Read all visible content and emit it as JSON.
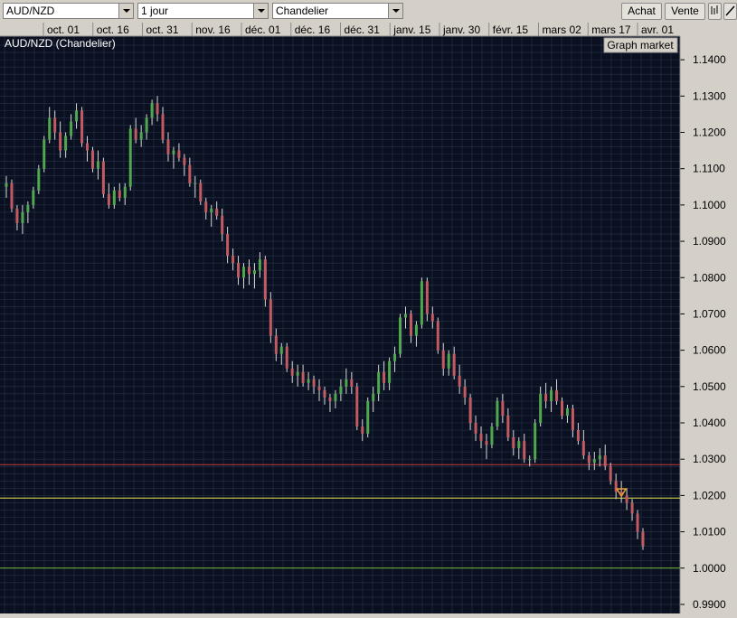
{
  "toolbar": {
    "instrument": "AUD/NZD",
    "timeframe": "1 jour",
    "chart_style": "Chandelier",
    "buy_label": "Achat",
    "sell_label": "Vente"
  },
  "chart_label": "AUD/NZD (Chandelier)",
  "graph_market_label": "Graph market",
  "colors": {
    "background": "#0a1020",
    "grid": "#26334d",
    "up": "#4fa84f",
    "down": "#c25a62",
    "wick": "#d8d8d8",
    "red_line": "#c23b3b",
    "yellow_line": "#e6e64c",
    "green_line": "#7ab83a",
    "marker": "#f0a030"
  },
  "chart_data": {
    "type": "candlestick",
    "x_ticks": [
      "oct. 01",
      "oct. 16",
      "oct. 31",
      "nov. 16",
      "déc. 01",
      "déc. 16",
      "déc. 31",
      "janv. 15",
      "janv. 30",
      "févr. 15",
      "mars 02",
      "mars 17",
      "avr. 01"
    ],
    "y_ticks": [
      "1.1400",
      "1.1300",
      "1.1200",
      "1.1100",
      "1.1000",
      "1.0900",
      "1.0800",
      "1.0700",
      "1.0600",
      "1.0500",
      "1.0400",
      "1.0300",
      "1.0200",
      "1.0100",
      "1.0000",
      "0.9900"
    ],
    "ylim": [
      0.9875,
      1.1465
    ],
    "horizontal_lines": [
      {
        "value": 1.0285,
        "color": "red"
      },
      {
        "value": 1.0193,
        "color": "yellow"
      },
      {
        "value": 1.0,
        "color": "green"
      }
    ],
    "marker": {
      "value": 1.0208,
      "shape": "triangle-down"
    },
    "candles": [
      [
        1.105,
        1.108,
        1.102,
        1.106
      ],
      [
        1.106,
        1.107,
        1.098,
        1.099
      ],
      [
        1.099,
        1.1,
        1.093,
        1.095
      ],
      [
        1.095,
        1.1,
        1.092,
        1.098
      ],
      [
        1.098,
        1.101,
        1.095,
        1.1
      ],
      [
        1.1,
        1.105,
        1.099,
        1.104
      ],
      [
        1.104,
        1.111,
        1.103,
        1.11
      ],
      [
        1.11,
        1.119,
        1.109,
        1.118
      ],
      [
        1.118,
        1.127,
        1.117,
        1.124
      ],
      [
        1.124,
        1.126,
        1.118,
        1.12
      ],
      [
        1.12,
        1.123,
        1.113,
        1.115
      ],
      [
        1.115,
        1.12,
        1.113,
        1.119
      ],
      [
        1.119,
        1.125,
        1.118,
        1.123
      ],
      [
        1.123,
        1.128,
        1.121,
        1.126
      ],
      [
        1.126,
        1.127,
        1.116,
        1.117
      ],
      [
        1.117,
        1.119,
        1.112,
        1.115
      ],
      [
        1.115,
        1.116,
        1.109,
        1.11
      ],
      [
        1.11,
        1.115,
        1.107,
        1.112
      ],
      [
        1.112,
        1.113,
        1.102,
        1.103
      ],
      [
        1.103,
        1.106,
        1.099,
        1.1
      ],
      [
        1.1,
        1.105,
        1.099,
        1.104
      ],
      [
        1.104,
        1.106,
        1.101,
        1.102
      ],
      [
        1.102,
        1.106,
        1.1,
        1.105
      ],
      [
        1.105,
        1.122,
        1.104,
        1.121
      ],
      [
        1.121,
        1.124,
        1.117,
        1.118
      ],
      [
        1.118,
        1.122,
        1.116,
        1.12
      ],
      [
        1.12,
        1.125,
        1.118,
        1.124
      ],
      [
        1.124,
        1.129,
        1.122,
        1.128
      ],
      [
        1.128,
        1.13,
        1.123,
        1.125
      ],
      [
        1.125,
        1.127,
        1.117,
        1.118
      ],
      [
        1.118,
        1.12,
        1.112,
        1.114
      ],
      [
        1.114,
        1.116,
        1.11,
        1.115
      ],
      [
        1.115,
        1.117,
        1.112,
        1.113
      ],
      [
        1.113,
        1.114,
        1.108,
        1.111
      ],
      [
        1.111,
        1.113,
        1.105,
        1.106
      ],
      [
        1.106,
        1.108,
        1.102,
        1.106
      ],
      [
        1.106,
        1.107,
        1.1,
        1.101
      ],
      [
        1.101,
        1.102,
        1.096,
        1.098
      ],
      [
        1.098,
        1.1,
        1.094,
        1.099
      ],
      [
        1.099,
        1.101,
        1.096,
        1.097
      ],
      [
        1.097,
        1.099,
        1.09,
        1.092
      ],
      [
        1.092,
        1.094,
        1.084,
        1.086
      ],
      [
        1.086,
        1.088,
        1.082,
        1.084
      ],
      [
        1.084,
        1.086,
        1.078,
        1.08
      ],
      [
        1.08,
        1.084,
        1.077,
        1.083
      ],
      [
        1.083,
        1.085,
        1.078,
        1.081
      ],
      [
        1.081,
        1.084,
        1.077,
        1.082
      ],
      [
        1.082,
        1.087,
        1.08,
        1.085
      ],
      [
        1.085,
        1.086,
        1.072,
        1.074
      ],
      [
        1.074,
        1.076,
        1.062,
        1.064
      ],
      [
        1.064,
        1.066,
        1.057,
        1.059
      ],
      [
        1.059,
        1.062,
        1.056,
        1.061
      ],
      [
        1.061,
        1.062,
        1.054,
        1.055
      ],
      [
        1.055,
        1.057,
        1.051,
        1.053
      ],
      [
        1.053,
        1.056,
        1.05,
        1.054
      ],
      [
        1.054,
        1.056,
        1.05,
        1.051
      ],
      [
        1.051,
        1.054,
        1.049,
        1.052
      ],
      [
        1.052,
        1.053,
        1.048,
        1.05
      ],
      [
        1.05,
        1.052,
        1.046,
        1.049
      ],
      [
        1.049,
        1.05,
        1.045,
        1.047
      ],
      [
        1.047,
        1.048,
        1.043,
        1.046
      ],
      [
        1.046,
        1.049,
        1.044,
        1.048
      ],
      [
        1.048,
        1.052,
        1.046,
        1.05
      ],
      [
        1.05,
        1.055,
        1.048,
        1.052
      ],
      [
        1.052,
        1.054,
        1.048,
        1.05
      ],
      [
        1.05,
        1.051,
        1.038,
        1.039
      ],
      [
        1.039,
        1.041,
        1.035,
        1.037
      ],
      [
        1.037,
        1.047,
        1.036,
        1.046
      ],
      [
        1.046,
        1.05,
        1.043,
        1.048
      ],
      [
        1.048,
        1.056,
        1.046,
        1.054
      ],
      [
        1.054,
        1.057,
        1.049,
        1.051
      ],
      [
        1.051,
        1.058,
        1.049,
        1.057
      ],
      [
        1.057,
        1.061,
        1.054,
        1.059
      ],
      [
        1.059,
        1.07,
        1.058,
        1.069
      ],
      [
        1.069,
        1.072,
        1.066,
        1.07
      ],
      [
        1.07,
        1.071,
        1.062,
        1.064
      ],
      [
        1.064,
        1.068,
        1.061,
        1.067
      ],
      [
        1.067,
        1.08,
        1.066,
        1.079
      ],
      [
        1.079,
        1.08,
        1.068,
        1.07
      ],
      [
        1.07,
        1.072,
        1.066,
        1.068
      ],
      [
        1.068,
        1.069,
        1.059,
        1.06
      ],
      [
        1.06,
        1.062,
        1.053,
        1.055
      ],
      [
        1.055,
        1.06,
        1.053,
        1.059
      ],
      [
        1.059,
        1.061,
        1.052,
        1.053
      ],
      [
        1.053,
        1.056,
        1.048,
        1.05
      ],
      [
        1.05,
        1.052,
        1.045,
        1.047
      ],
      [
        1.047,
        1.048,
        1.038,
        1.04
      ],
      [
        1.04,
        1.042,
        1.035,
        1.037
      ],
      [
        1.037,
        1.039,
        1.033,
        1.035
      ],
      [
        1.035,
        1.037,
        1.03,
        1.034
      ],
      [
        1.034,
        1.04,
        1.033,
        1.039
      ],
      [
        1.039,
        1.047,
        1.038,
        1.046
      ],
      [
        1.046,
        1.048,
        1.04,
        1.042
      ],
      [
        1.042,
        1.044,
        1.035,
        1.036
      ],
      [
        1.036,
        1.038,
        1.031,
        1.033
      ],
      [
        1.033,
        1.036,
        1.03,
        1.035
      ],
      [
        1.035,
        1.037,
        1.029,
        1.03
      ],
      [
        1.03,
        1.031,
        1.028,
        1.03
      ],
      [
        1.03,
        1.041,
        1.029,
        1.04
      ],
      [
        1.04,
        1.05,
        1.039,
        1.048
      ],
      [
        1.048,
        1.051,
        1.044,
        1.046
      ],
      [
        1.046,
        1.05,
        1.043,
        1.049
      ],
      [
        1.049,
        1.052,
        1.045,
        1.046
      ],
      [
        1.046,
        1.047,
        1.041,
        1.042
      ],
      [
        1.042,
        1.045,
        1.04,
        1.044
      ],
      [
        1.044,
        1.045,
        1.036,
        1.038
      ],
      [
        1.038,
        1.04,
        1.034,
        1.035
      ],
      [
        1.035,
        1.038,
        1.03,
        1.031
      ],
      [
        1.031,
        1.032,
        1.027,
        1.029
      ],
      [
        1.029,
        1.032,
        1.027,
        1.03
      ],
      [
        1.03,
        1.033,
        1.028,
        1.031
      ],
      [
        1.031,
        1.034,
        1.027,
        1.028
      ],
      [
        1.028,
        1.029,
        1.023,
        1.024
      ],
      [
        1.024,
        1.026,
        1.019,
        1.021
      ],
      [
        1.021,
        1.024,
        1.018,
        1.02
      ],
      [
        1.02,
        1.022,
        1.016,
        1.018
      ],
      [
        1.018,
        1.019,
        1.013,
        1.015
      ],
      [
        1.015,
        1.016,
        1.008,
        1.01
      ],
      [
        1.01,
        1.011,
        1.005,
        1.006
      ]
    ]
  }
}
